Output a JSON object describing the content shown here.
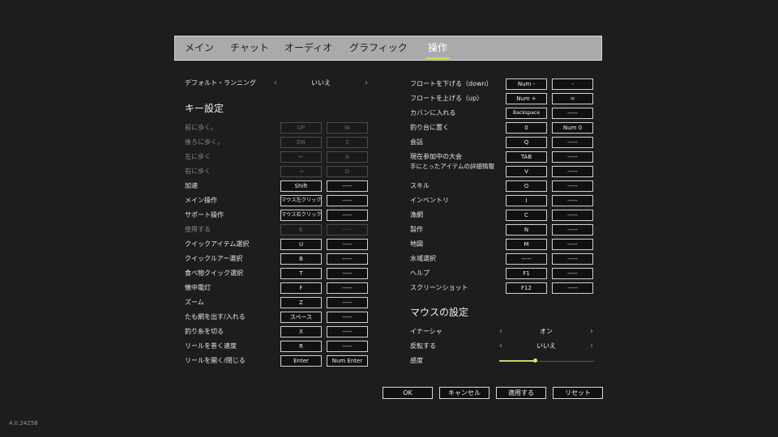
{
  "tabs": [
    {
      "label": "メイン"
    },
    {
      "label": "チャット"
    },
    {
      "label": "オーディオ"
    },
    {
      "label": "グラフィック"
    },
    {
      "label": "操作",
      "active": true
    }
  ],
  "default_running": {
    "label": "デフォルト・ランニング",
    "value": "いいえ"
  },
  "key_section_title": "キー設定",
  "left_rows": [
    {
      "label": "前に歩く。",
      "key1": "UP",
      "key2": "W",
      "disabled": true
    },
    {
      "label": "後ろに歩く。",
      "key1": "DN",
      "key2": "S",
      "disabled": true
    },
    {
      "label": "左に歩く",
      "key1": "←",
      "key2": "A",
      "disabled": true
    },
    {
      "label": "右に歩く",
      "key1": "→",
      "key2": "D",
      "disabled": true
    },
    {
      "label": "加速",
      "key1": "Shift",
      "key2": "-----"
    },
    {
      "label": "メイン操作",
      "key1": "マウス左クリック",
      "key2": "-----"
    },
    {
      "label": "サポート操作",
      "key1": "マウス右クリック",
      "key2": "-----"
    },
    {
      "label": "使用する",
      "key1": "E",
      "key2": "-----",
      "disabled": true
    },
    {
      "label": "クイックアイテム選択",
      "key1": "U",
      "key2": "-----"
    },
    {
      "label": "クイックルアー選択",
      "key1": "B",
      "key2": "-----"
    },
    {
      "label": "食べ物クイック選択",
      "key1": "T",
      "key2": "-----"
    },
    {
      "label": "懐中電灯",
      "key1": "F",
      "key2": "-----"
    },
    {
      "label": "ズーム",
      "key1": "Z",
      "key2": "-----"
    },
    {
      "label": "たも網を出す/入れる",
      "key1": "スペース",
      "key2": "-----"
    },
    {
      "label": "釣り糸を切る",
      "key1": "X",
      "key2": "-----"
    },
    {
      "label": "リールを巻く速度",
      "key1": "R",
      "key2": "-----"
    },
    {
      "label": "リールを開く/閉じる",
      "key1": "Enter",
      "key2": "Num Enter"
    }
  ],
  "right_rows": [
    {
      "label": "フロートを下げる（down）",
      "key1": "Num -",
      "key2": "-"
    },
    {
      "label": "フロートを上げる（up）",
      "key1": "Num +",
      "key2": "="
    },
    {
      "label": "カバンに入れる",
      "key1": "Backspace",
      "key2": "-----"
    },
    {
      "label": "釣り台に置く",
      "key1": "0",
      "key2": "Num 0"
    },
    {
      "label": "会話",
      "key1": "Q",
      "key2": "-----"
    },
    {
      "label": "現在参加中の大会",
      "key1": "TAB",
      "key2": "-----"
    },
    {
      "label": "手にとったアイテムの詳細情報",
      "key1": "V",
      "key2": "-----",
      "two_line": true
    },
    {
      "label": "スキル",
      "key1": "O",
      "key2": "-----"
    },
    {
      "label": "インベントリ",
      "key1": "I",
      "key2": "-----"
    },
    {
      "label": "漁網",
      "key1": "C",
      "key2": "-----"
    },
    {
      "label": "製作",
      "key1": "N",
      "key2": "-----"
    },
    {
      "label": "地図",
      "key1": "M",
      "key2": "-----"
    },
    {
      "label": "水域選択",
      "key1": "-----",
      "key2": "-----"
    },
    {
      "label": "ヘルプ",
      "key1": "F1",
      "key2": "-----"
    },
    {
      "label": "スクリーンショット",
      "key1": "F12",
      "key2": "-----"
    }
  ],
  "mouse_section_title": "マウスの設定",
  "inertia": {
    "label": "イナーシャ",
    "value": "オン"
  },
  "invert": {
    "label": "反転する",
    "value": "いいえ"
  },
  "sensitivity": {
    "label": "感度",
    "value": 0.38
  },
  "buttons": {
    "ok": "OK",
    "cancel": "キャンセル",
    "apply": "適用する",
    "reset": "リセット"
  },
  "arrows": {
    "left": "‹",
    "right": "›"
  },
  "version": "4.0.24258",
  "colors": {
    "background": "#1d1d1d",
    "tabbar": "#aaaaaa",
    "accent": "#d4d85a"
  }
}
